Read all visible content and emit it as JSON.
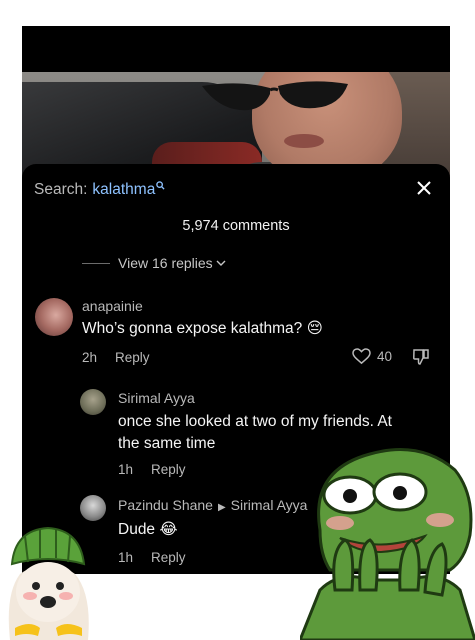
{
  "search": {
    "label": "Search:",
    "term": "kalathma"
  },
  "comments_header": {
    "count_text": "5,974 comments"
  },
  "view_replies": "View 16 replies",
  "comments": [
    {
      "username": "anapainie",
      "text": "Who’s gonna expose kalathma?",
      "emoji": "😔",
      "time": "2h",
      "reply_label": "Reply",
      "likes": "40"
    }
  ],
  "replies": [
    {
      "username": "Sirimal Ayya",
      "text_line1": "once she looked at two of my friends. At",
      "text_line2": "the same time",
      "time": "1h",
      "reply_label": "Reply"
    },
    {
      "username": "Pazindu Shane",
      "reply_to": "Sirimal Ayya",
      "text": "Dude",
      "emoji": "😂",
      "time": "1h",
      "reply_label": "Reply"
    }
  ],
  "colors": {
    "sheet_bg": "#000000",
    "link_blue": "#8ec2ff",
    "muted_text": "#b9b9b9"
  },
  "icons": [
    "search-icon",
    "close-icon",
    "heart-icon",
    "dislike-icon",
    "chevron-down-icon",
    "triangle-right-icon"
  ]
}
